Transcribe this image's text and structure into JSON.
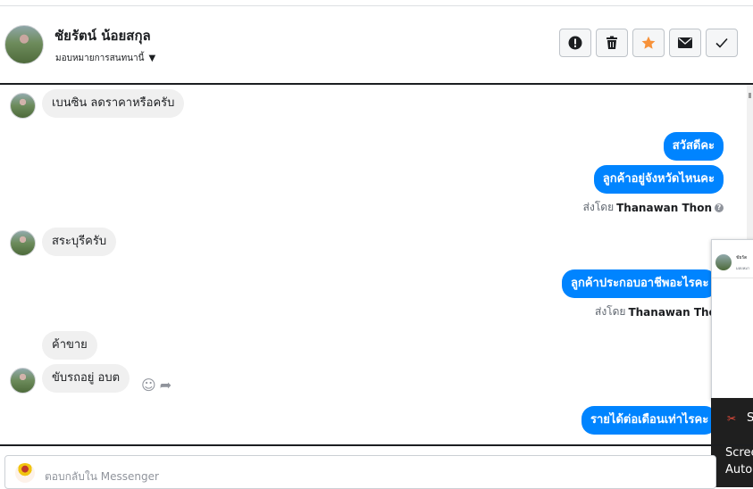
{
  "header": {
    "contact_name": "ชัยรัตน์ น้อยสกุล",
    "assign_label": "มอบหมายการสนทนานี้",
    "actions": [
      {
        "name": "spam-button",
        "icon": "exclamation-icon"
      },
      {
        "name": "delete-button",
        "icon": "trash-icon"
      },
      {
        "name": "star-button",
        "icon": "star-icon",
        "color": "#f7923a"
      },
      {
        "name": "unread-button",
        "icon": "envelope-icon"
      },
      {
        "name": "done-button",
        "icon": "checkmark-icon"
      }
    ]
  },
  "messages": {
    "m1": "เบนซิน ลดราคาหรือครับ",
    "m2": "สวัสดีคะ",
    "m3": "ลูกค้าอยู่จังหวัดไหนคะ",
    "m4": "สระบุรีครับ",
    "m5": "ลูกค้าประกอบอาชีพอะไรคะ",
    "m6": "ค้าขาย",
    "m7": "ขับรถอยู่ อบต",
    "m8": "รายได้ต่อเดือนเท่าไรคะ"
  },
  "sent_by": {
    "prefix": "ส่งโดย",
    "name": "Thanawan Thon"
  },
  "popup": {
    "title": "ชัยรัต",
    "subtitle": "มอบหมา"
  },
  "toast": {
    "s": "S",
    "line1": "Scree",
    "line2": "Auto"
  },
  "composer": {
    "placeholder": "ตอบกลับใน Messenger"
  },
  "colors": {
    "outgoing_bubble": "#0084ff",
    "incoming_bubble": "#f0f0f0",
    "star": "#f7923a"
  }
}
